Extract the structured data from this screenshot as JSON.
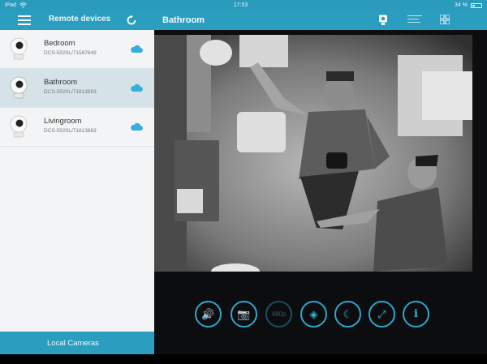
{
  "statusbar": {
    "carrier": "iPad",
    "time": "17:53",
    "battery": "34 %"
  },
  "sidebar": {
    "title": "Remote devices",
    "devices": [
      {
        "name": "Bedroom",
        "id": "DCS-5020L/71587649",
        "selected": false
      },
      {
        "name": "Bathroom",
        "id": "DCS-5020L/71613893",
        "selected": true
      },
      {
        "name": "Livingroom",
        "id": "DCS-5020L/71613883",
        "selected": false
      }
    ],
    "local_label": "Local Cameras"
  },
  "main": {
    "title": "Bathroom",
    "controls": [
      {
        "icon": "speaker-icon",
        "glyph": "🔊"
      },
      {
        "icon": "camera-snapshot-icon",
        "glyph": "📷"
      },
      {
        "icon": "resolution-icon",
        "glyph": "480p"
      },
      {
        "icon": "pan-tilt-icon",
        "glyph": "◈"
      },
      {
        "icon": "night-mode-icon",
        "glyph": "☾"
      },
      {
        "icon": "fullscreen-icon",
        "glyph": "⤢"
      },
      {
        "icon": "info-icon",
        "glyph": "i"
      }
    ]
  },
  "colors": {
    "accent": "#2b9ec0",
    "sidebar_bg": "#f3f4f5",
    "selected_row": "#d5e3e8",
    "control_ring": "#2fa6cc"
  }
}
